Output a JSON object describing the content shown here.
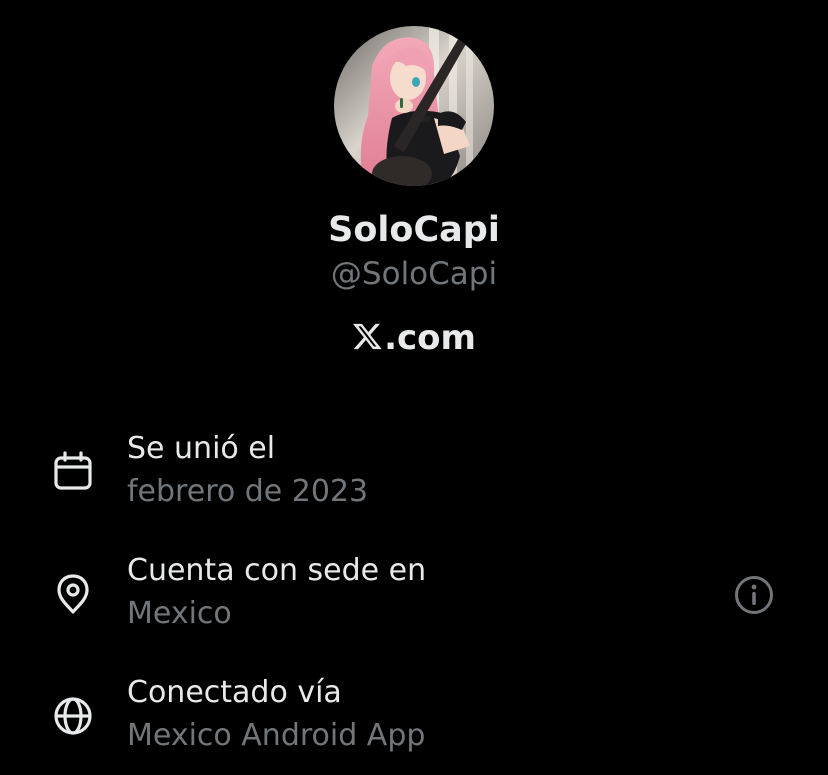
{
  "profile": {
    "display_name": "SoloCapi",
    "handle": "@SoloCapi",
    "site": ".com",
    "site_logo": "x-logo-icon"
  },
  "about": {
    "joined": {
      "title": "Se unió el",
      "value": "febrero de 2023",
      "icon": "calendar-icon"
    },
    "location": {
      "title": "Cuenta con sede en",
      "value": "Mexico",
      "icon": "location-pin-icon",
      "info_icon": "info-icon"
    },
    "connected": {
      "title": "Conectado vía",
      "value": "Mexico Android App",
      "icon": "globe-icon"
    }
  },
  "colors": {
    "background": "#000000",
    "primary_text": "#e7e9ea",
    "secondary_text": "#71767b"
  }
}
